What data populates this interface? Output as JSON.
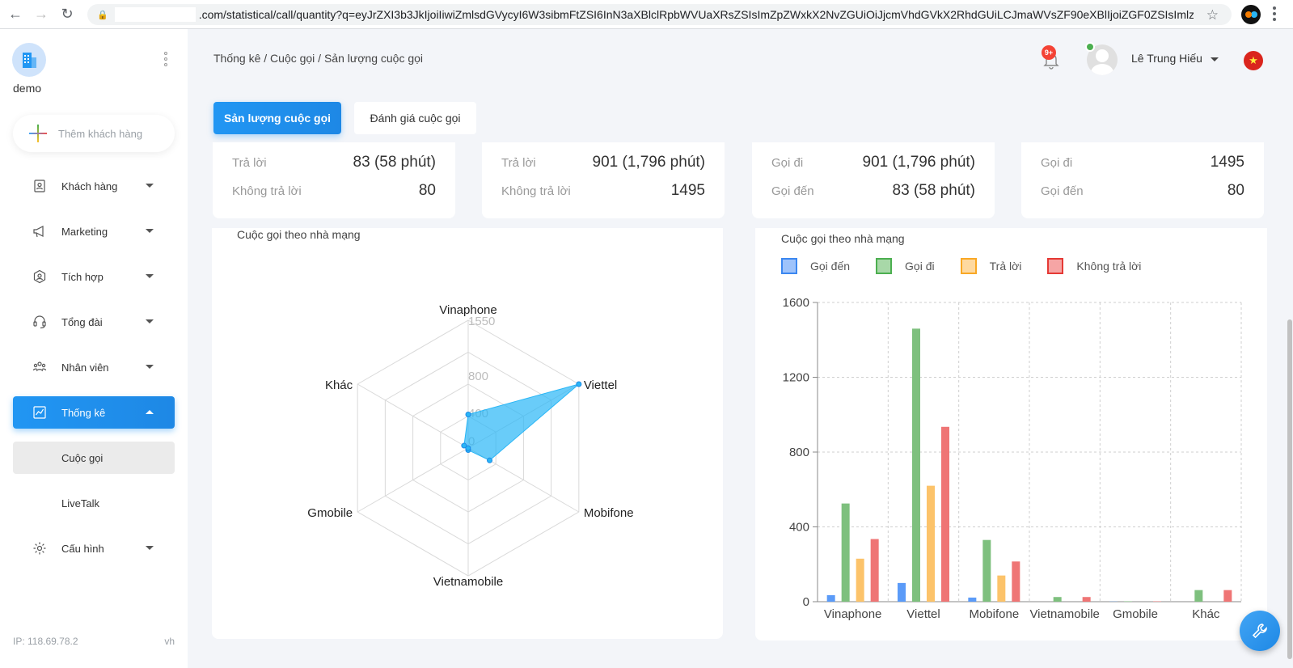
{
  "browser": {
    "url": ".com/statistical/call/quantity?q=eyJrZXI3b3JkIjoiIiwiZmlsdGVycyI6W3sibmFtZSI6InN3aXBlclRpbWVUaXRsZSIsImZpZWxkX2NvZGUiOiJjcmVhdGVkX2RhdGUiLCJmaWVsZF90eXBlIjoiZGF0ZSIsImlzX2hhcm..."
  },
  "sidebar": {
    "company": "demo",
    "add_customer": "Thêm khách hàng",
    "items": [
      {
        "label": "Khách hàng"
      },
      {
        "label": "Marketing"
      },
      {
        "label": "Tích hợp"
      },
      {
        "label": "Tổng đài"
      },
      {
        "label": "Nhân viên"
      },
      {
        "label": "Thống kê"
      }
    ],
    "sub_items": [
      {
        "label": "Cuộc gọi"
      },
      {
        "label": "LiveTalk"
      }
    ],
    "config": "Cấu hình",
    "ip": "IP: 118.69.78.2",
    "version": "vh"
  },
  "header": {
    "breadcrumb": "Thống kê / Cuộc gọi / Sản lượng cuộc gọi",
    "notification_badge": "9+",
    "username": "Lê Trung Hiếu",
    "flag_icon": "vietnam-flag-icon"
  },
  "tabs": [
    {
      "label": "Sản lượng cuộc gọi"
    },
    {
      "label": "Đánh giá cuộc gọi"
    }
  ],
  "stat_cards": [
    {
      "rows": [
        {
          "label": "Trả lời",
          "value": "83 (58 phút)"
        },
        {
          "label": "Không trả lời",
          "value": "80"
        }
      ]
    },
    {
      "rows": [
        {
          "label": "Trả lời",
          "value": "901 (1,796 phút)"
        },
        {
          "label": "Không trả lời",
          "value": "1495"
        }
      ]
    },
    {
      "rows": [
        {
          "label": "Gọi đi",
          "value": "901 (1,796 phút)"
        },
        {
          "label": "Gọi đến",
          "value": "83 (58 phút)"
        }
      ]
    },
    {
      "rows": [
        {
          "label": "Gọi đi",
          "value": "1495"
        },
        {
          "label": "Gọi đến",
          "value": "80"
        }
      ]
    }
  ],
  "radar_panel": {
    "title": "Cuộc gọi theo nhà mạng"
  },
  "bar_panel": {
    "title": "Cuộc gọi theo nhà mạng",
    "legend": [
      "Gọi đến",
      "Gọi đi",
      "Trả lời",
      "Không trả lời"
    ]
  },
  "chart_data": [
    {
      "type": "radar",
      "title": "Cuộc gọi theo nhà mạng",
      "categories": [
        "Vinaphone",
        "Viettel",
        "Mobifone",
        "Vietnamobile",
        "Gmobile",
        "Khác"
      ],
      "values": [
        420,
        1600,
        310,
        25,
        2,
        60
      ],
      "tick_labels": [
        "0",
        "400",
        "800",
        "1550"
      ],
      "color": "#4fc3f7"
    },
    {
      "type": "bar",
      "title": "Cuộc gọi theo nhà mạng",
      "categories": [
        "Vinaphone",
        "Viettel",
        "Mobifone",
        "Vietnamobile",
        "Gmobile",
        "Khác"
      ],
      "ylim": [
        0,
        1600
      ],
      "yticks": [
        0,
        400,
        800,
        1200,
        1600
      ],
      "grid": true,
      "series": [
        {
          "name": "Gọi đến",
          "color": "#5b9bf8",
          "values": [
            35,
            100,
            22,
            0,
            1,
            0
          ]
        },
        {
          "name": "Gọi đi",
          "color": "#7ec07e",
          "values": [
            525,
            1460,
            330,
            25,
            2,
            62
          ]
        },
        {
          "name": "Trả lời",
          "color": "#fcc36a",
          "values": [
            230,
            620,
            140,
            0,
            0,
            0
          ]
        },
        {
          "name": "Không trả lời",
          "color": "#ef7575",
          "values": [
            335,
            935,
            215,
            25,
            2,
            62
          ]
        }
      ]
    }
  ]
}
